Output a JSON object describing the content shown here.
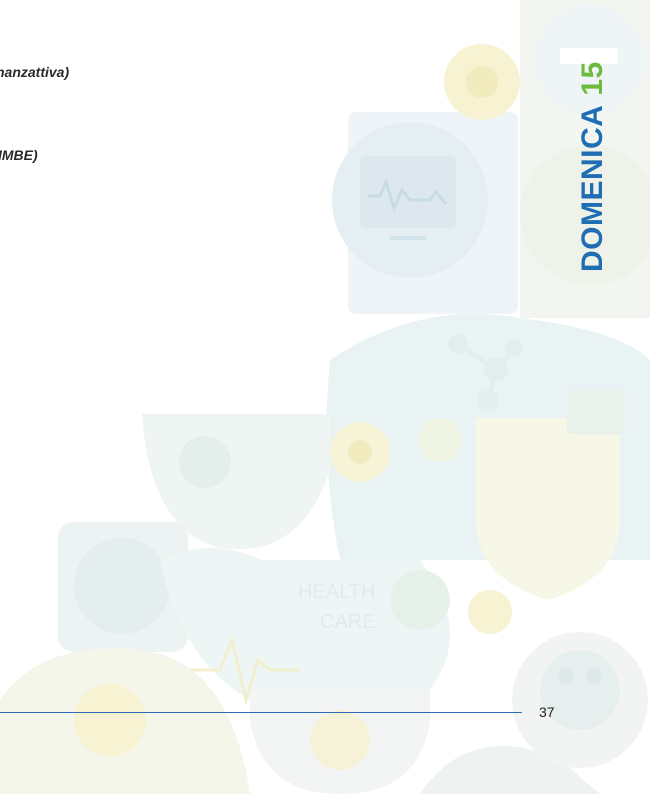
{
  "body_text": {
    "fragment_1": "nanzattiva)",
    "fragment_2": "IMBE)"
  },
  "side_title": {
    "day": "DOMENICA",
    "number": "15"
  },
  "background": {
    "watermark_text_line1": "HEALTH",
    "watermark_text_line2": "CARE"
  },
  "footer": {
    "page_number": "37",
    "rule_color": "#2c6bb5"
  },
  "colors": {
    "title_blue": "#1f6db3",
    "title_green": "#6dbb3e"
  }
}
